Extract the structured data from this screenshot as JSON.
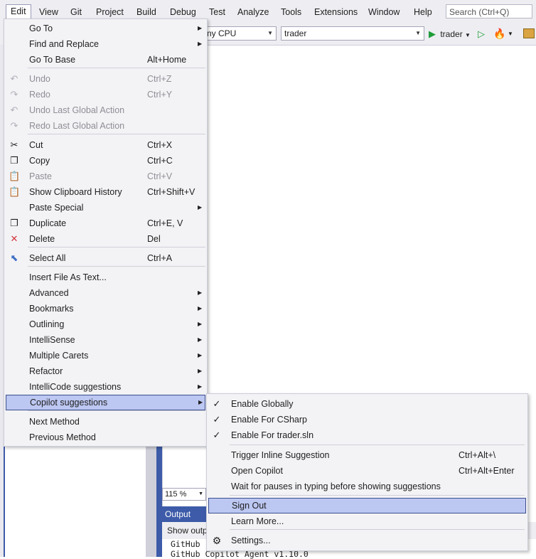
{
  "menubar": {
    "items": [
      "Edit",
      "View",
      "Git",
      "Project",
      "Build",
      "Debug",
      "Test",
      "Analyze",
      "Tools",
      "Extensions",
      "Window",
      "Help"
    ],
    "search_placeholder": "Search (Ctrl+Q)"
  },
  "toolbar": {
    "platform": "ny CPU",
    "project": "trader",
    "run_label": "trader"
  },
  "edit_menu": {
    "items": [
      {
        "label": "Go To",
        "shortcut": "",
        "submenu": true,
        "disabled": false,
        "icon": ""
      },
      {
        "label": "Find and Replace",
        "shortcut": "",
        "submenu": true,
        "disabled": false,
        "icon": ""
      },
      {
        "label": "Go To Base",
        "shortcut": "Alt+Home",
        "submenu": false,
        "disabled": false,
        "icon": ""
      },
      {
        "label": "Undo",
        "shortcut": "Ctrl+Z",
        "submenu": false,
        "disabled": true,
        "icon": "undo-icon"
      },
      {
        "label": "Redo",
        "shortcut": "Ctrl+Y",
        "submenu": false,
        "disabled": true,
        "icon": "redo-icon"
      },
      {
        "label": "Undo Last Global Action",
        "shortcut": "",
        "submenu": false,
        "disabled": true,
        "icon": "undo-icon"
      },
      {
        "label": "Redo Last Global Action",
        "shortcut": "",
        "submenu": false,
        "disabled": true,
        "icon": "redo-icon"
      },
      {
        "label": "Cut",
        "shortcut": "Ctrl+X",
        "submenu": false,
        "disabled": false,
        "icon": "scissors-icon"
      },
      {
        "label": "Copy",
        "shortcut": "Ctrl+C",
        "submenu": false,
        "disabled": false,
        "icon": "copy-icon"
      },
      {
        "label": "Paste",
        "shortcut": "Ctrl+V",
        "submenu": false,
        "disabled": true,
        "icon": "paste-icon"
      },
      {
        "label": "Show Clipboard History",
        "shortcut": "Ctrl+Shift+V",
        "submenu": false,
        "disabled": false,
        "icon": "clipboard-icon"
      },
      {
        "label": "Paste Special",
        "shortcut": "",
        "submenu": true,
        "disabled": false,
        "icon": ""
      },
      {
        "label": "Duplicate",
        "shortcut": "Ctrl+E, V",
        "submenu": false,
        "disabled": false,
        "icon": "duplicate-icon"
      },
      {
        "label": "Delete",
        "shortcut": "Del",
        "submenu": false,
        "disabled": false,
        "icon": "delete-icon"
      },
      {
        "label": "Select All",
        "shortcut": "Ctrl+A",
        "submenu": false,
        "disabled": false,
        "icon": "select-all-icon"
      },
      {
        "label": "Insert File As Text...",
        "shortcut": "",
        "submenu": false,
        "disabled": false,
        "icon": ""
      },
      {
        "label": "Advanced",
        "shortcut": "",
        "submenu": true,
        "disabled": false,
        "icon": ""
      },
      {
        "label": "Bookmarks",
        "shortcut": "",
        "submenu": true,
        "disabled": false,
        "icon": ""
      },
      {
        "label": "Outlining",
        "shortcut": "",
        "submenu": true,
        "disabled": false,
        "icon": ""
      },
      {
        "label": "IntelliSense",
        "shortcut": "",
        "submenu": true,
        "disabled": false,
        "icon": ""
      },
      {
        "label": "Multiple Carets",
        "shortcut": "",
        "submenu": true,
        "disabled": false,
        "icon": ""
      },
      {
        "label": "Refactor",
        "shortcut": "",
        "submenu": true,
        "disabled": false,
        "icon": ""
      },
      {
        "label": "IntelliCode suggestions",
        "shortcut": "",
        "submenu": true,
        "disabled": false,
        "icon": ""
      },
      {
        "label": "Copilot suggestions",
        "shortcut": "",
        "submenu": true,
        "disabled": false,
        "icon": "",
        "highlighted": true
      },
      {
        "label": "Next Method",
        "shortcut": "",
        "submenu": false,
        "disabled": false,
        "icon": ""
      },
      {
        "label": "Previous Method",
        "shortcut": "",
        "submenu": false,
        "disabled": false,
        "icon": ""
      }
    ]
  },
  "copilot_menu": {
    "items": [
      {
        "label": "Enable Globally",
        "shortcut": "",
        "checked": true
      },
      {
        "label": "Enable For CSharp",
        "shortcut": "",
        "checked": true
      },
      {
        "label": "Enable For trader.sln",
        "shortcut": "",
        "checked": true
      },
      {
        "label": "Trigger Inline Suggestion",
        "shortcut": "Ctrl+Alt+\\",
        "checked": false
      },
      {
        "label": "Open Copilot",
        "shortcut": "Ctrl+Alt+Enter",
        "checked": false
      },
      {
        "label": "Wait for pauses in typing before showing suggestions",
        "shortcut": "",
        "checked": false
      },
      {
        "label": "Sign Out",
        "shortcut": "",
        "checked": false,
        "highlighted": true
      },
      {
        "label": "Learn More...",
        "shortcut": "",
        "checked": false
      },
      {
        "label": "Settings...",
        "shortcut": "",
        "checked": false,
        "icon": "gear-icon"
      }
    ]
  },
  "bottom": {
    "zoom": "115 %",
    "output_title": "Output",
    "show_output": "Show outp",
    "output_lines": [
      "GitHub",
      "GitHub Copilot Agent v1.10.0"
    ]
  }
}
